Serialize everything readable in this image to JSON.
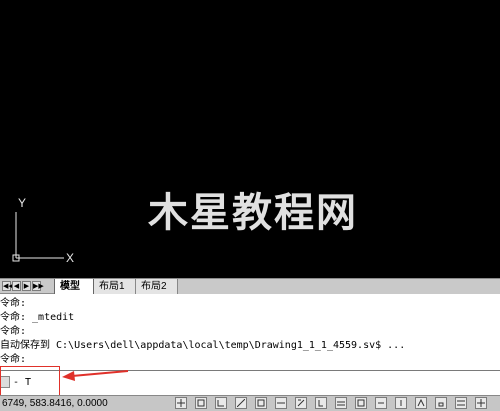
{
  "canvas": {
    "ucs": {
      "y_label": "Y",
      "x_label": "X"
    },
    "watermark": "木星教程网"
  },
  "layout_tabs": {
    "nav": [
      "◀◀",
      "◀",
      "▶",
      "▶▶"
    ],
    "tabs": [
      {
        "label": "模型",
        "active": true
      },
      {
        "label": "布局1",
        "active": false
      },
      {
        "label": "布局2",
        "active": false
      }
    ]
  },
  "command_history": {
    "lines": [
      "令命:",
      "令命: _mtedit",
      "令命:",
      "自动保存到 C:\\Users\\dell\\appdata\\local\\temp\\Drawing1_1_1_4559.sv$ ...",
      "令命:"
    ]
  },
  "command_input": {
    "value": "- T"
  },
  "status_bar": {
    "coordinates": "6749, 583.8416, 0.0000",
    "button_icons": [
      "snap-icon",
      "grid-icon",
      "ortho-icon",
      "polar-icon",
      "osnap-icon",
      "otrack-icon",
      "ducs-icon",
      "dyn-icon",
      "lwt-icon",
      "tpy-icon",
      "qp-icon",
      "sc-icon",
      "am-icon",
      "lock-icon",
      "annotation-icon",
      "clean-screen-icon"
    ]
  },
  "colors": {
    "canvas": "#000000",
    "highlight": "#e0312a",
    "panel": "#c9c9c9"
  }
}
